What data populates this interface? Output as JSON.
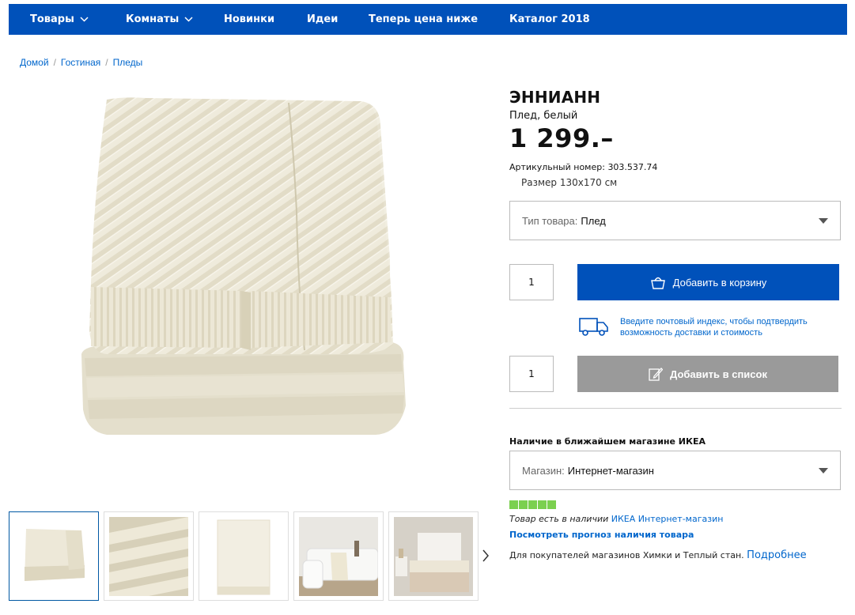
{
  "nav": {
    "items": [
      {
        "label": "Товары",
        "has_dropdown": true
      },
      {
        "label": "Комнаты",
        "has_dropdown": true
      },
      {
        "label": "Новинки",
        "has_dropdown": false
      },
      {
        "label": "Идеи",
        "has_dropdown": false
      },
      {
        "label": "Теперь цена ниже",
        "has_dropdown": false
      },
      {
        "label": "Каталог 2018",
        "has_dropdown": false
      }
    ],
    "bg_color": "#0051ba"
  },
  "breadcrumb": [
    "Домой",
    "Гостиная",
    "Пледы"
  ],
  "product": {
    "name": "ЭННИАНН",
    "description": "Плед, белый",
    "price": "1 299.–",
    "article_label": "Артикульный номер:",
    "article_number": "303.537.74",
    "size_label": "Размер",
    "size_value": "130x170 см"
  },
  "type_select": {
    "label": "Тип товара:",
    "value": "Плед"
  },
  "cart": {
    "quantity": "1",
    "button_label": "Добавить в корзину",
    "icon": "basket-icon",
    "color": "#0051ba"
  },
  "delivery": {
    "icon": "truck-icon",
    "text": "Введите почтовый индекс, чтобы подтвердить возможность доставки и стоимость"
  },
  "list": {
    "quantity": "1",
    "button_label": "Добавить в список",
    "icon": "edit-list-icon",
    "color": "#9a9a9a"
  },
  "stock": {
    "title": "Наличие в ближайшем магазине ИКЕА",
    "store_label": "Магазин:",
    "store_value": "Интернет-магазин",
    "level": 5,
    "level_max": 5,
    "status_text": "Товар есть в наличии",
    "status_store": "ИКЕА Интернет-магазин",
    "forecast_link": "Посмотреть прогноз наличия товара",
    "buyers_text": "Для покупателей магазинов Химки и Теплый стан.",
    "more_link": "Подробнее",
    "bar_color": "#7bd04f"
  },
  "thumbnails": [
    "blanket-folded-thumb",
    "blanket-closeup-thumb",
    "blanket-flat-thumb",
    "sofa-room-thumb",
    "bedroom-thumb"
  ]
}
